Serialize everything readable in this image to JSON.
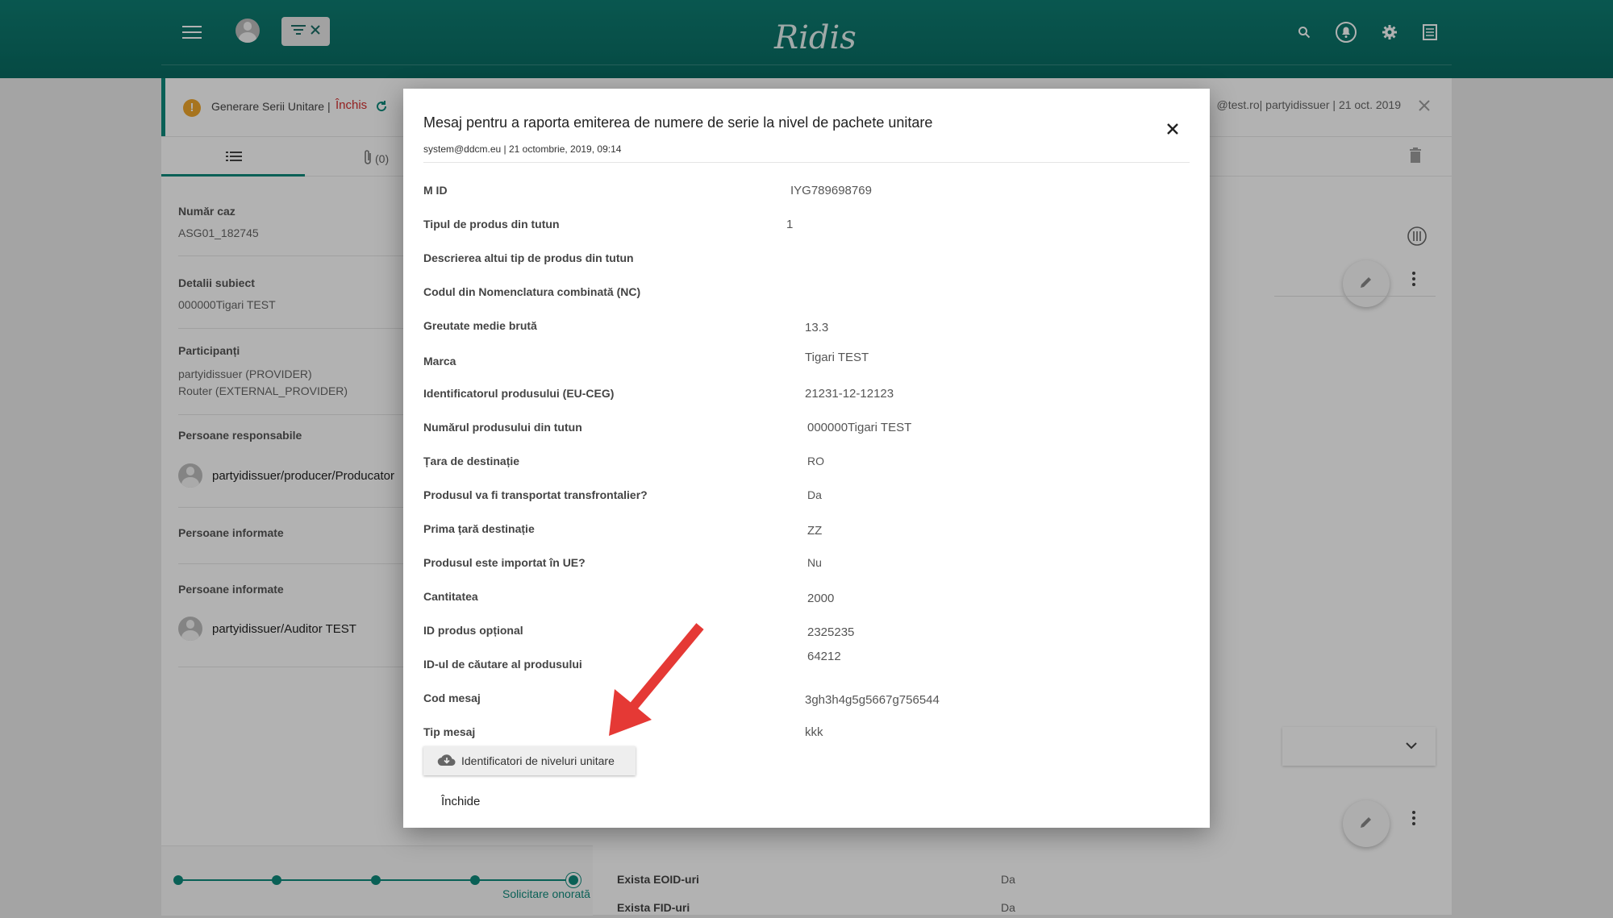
{
  "app": {
    "logo": "Ridis"
  },
  "header": {
    "icons": [
      "menu-icon",
      "avatar",
      "filter-icon",
      "close-icon",
      "search-icon",
      "notification-icon",
      "gear-icon",
      "document-icon"
    ]
  },
  "banner": {
    "title": "Generare Serii Unitare |",
    "status": "Închis",
    "meta": "@test.ro| partyidissuer | 21 oct. 2019"
  },
  "tabs": {
    "attachments": "(0)"
  },
  "case": {
    "number_label": "Număr caz",
    "number_value": "ASG01_182745",
    "subject_label": "Detalii subiect",
    "subject_value": "000000Tigari TEST",
    "participants_label": "Participanți",
    "participants": [
      "partyidissuer (PROVIDER)",
      "Router (EXTERNAL_PROVIDER)"
    ],
    "responsible_label": "Persoane responsabile",
    "responsible_person": "partyidissuer/producer/Producator",
    "informed_label_1": "Persoane informate",
    "informed_label_2": "Persoane informate",
    "informed_person": "partyidissuer/Auditor TEST"
  },
  "stepper": {
    "current_label": "Solicitare onorată"
  },
  "background_fields": [
    {
      "label": "Exista EOID-uri",
      "value": "Da"
    },
    {
      "label": "Exista FID-uri",
      "value": "Da"
    }
  ],
  "modal": {
    "title": "Mesaj pentru a raporta emiterea de numere de serie la nivel de pachete unitare",
    "subtitle": "system@ddcm.eu | 21 octombrie, 2019, 09:14",
    "fields": [
      {
        "label": "M ID",
        "value": "IYG789698769"
      },
      {
        "label": "Tipul de produs din tutun",
        "value": "1"
      },
      {
        "label": "Descrierea altui tip de produs din tutun",
        "value": ""
      },
      {
        "label": "Codul din Nomenclatura combinată (NC)",
        "value": ""
      },
      {
        "label": "Greutate medie brută",
        "value": "13.3"
      },
      {
        "label": "Marca",
        "value": "Tigari TEST"
      },
      {
        "label": "Identificatorul produsului (EU-CEG)",
        "value": "21231-12-12123"
      },
      {
        "label": "Numărul produsului din tutun",
        "value": "000000Tigari TEST"
      },
      {
        "label": "Țara de destinație",
        "value": "RO"
      },
      {
        "label": "Produsul va fi transportat transfrontalier?",
        "value": "Da"
      },
      {
        "label": "Prima țară destinație",
        "value": "ZZ"
      },
      {
        "label": "Produsul este importat în UE?",
        "value": "Nu"
      },
      {
        "label": "Cantitatea",
        "value": "2000"
      },
      {
        "label": "ID produs opțional",
        "value": "2325235"
      },
      {
        "label": "ID-ul de căutare al produsului",
        "value": "64212"
      },
      {
        "label": "Cod mesaj",
        "value": "3gh3h4g5g5667g756544"
      },
      {
        "label": "Tip mesaj",
        "value": "kkk"
      }
    ],
    "download_button": "Identificatori de niveluri unitare",
    "close_button": "Închide"
  },
  "colors": {
    "primary": "#0e7d72",
    "accent": "#0e8a7c",
    "warning": "#f0a62b",
    "status_closed": "#d32f2f",
    "annotation_arrow": "#e53935"
  }
}
